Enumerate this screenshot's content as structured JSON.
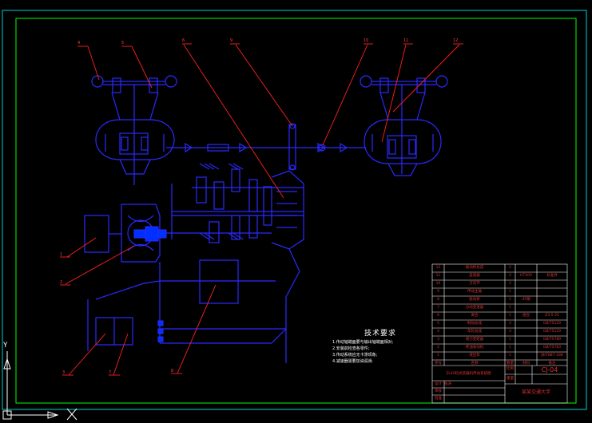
{
  "drawing": {
    "colors": {
      "background": "#000000",
      "border": "#00ff00",
      "frame": "#00d0d0",
      "mechanism": "#2a2aff",
      "leader": "#ff2020",
      "part_fill": "#0030ff"
    },
    "callouts": [
      "4",
      "5",
      "6",
      "9",
      "10",
      "11",
      "12",
      "1",
      "2",
      "3",
      "7",
      "8"
    ],
    "technical_requirements": {
      "title": "技术要求",
      "items": [
        "1.传动轴端面要与输出轴端面相对;",
        "2.安装前检查各零件;",
        "3.传动系统应无卡滞现象;",
        "4.减速器需要加油润滑."
      ]
    },
    "bom": {
      "rows": [
        {
          "no": "12",
          "name": "驱动桥总成",
          "qty": "2",
          "material": "",
          "note": ""
        },
        {
          "no": "11",
          "name": "差速器",
          "qty": "2",
          "material": "HT200",
          "note": "标准件"
        },
        {
          "no": "10",
          "name": "万向节",
          "qty": "2",
          "material": "",
          "note": ""
        },
        {
          "no": "9",
          "name": "传动主轴",
          "qty": "1",
          "material": "",
          "note": ""
        },
        {
          "no": "8",
          "name": "驱动桥",
          "qty": "1",
          "material": "45钢",
          "note": ""
        },
        {
          "no": "7",
          "name": "分动变速器",
          "qty": "1",
          "material": "",
          "note": ""
        },
        {
          "no": "6",
          "name": "离合",
          "qty": "1",
          "material": "组合",
          "note": "Z3.5-25"
        },
        {
          "no": "5",
          "name": "制动总成",
          "qty": "2",
          "material": "",
          "note": "GB/T5120"
        },
        {
          "no": "4",
          "name": "车轮总成",
          "qty": "4",
          "material": "",
          "note": "GB/T5120"
        },
        {
          "no": "3",
          "name": "液力变矩器",
          "qty": "1",
          "material": "",
          "note": "GB/T5780"
        },
        {
          "no": "2",
          "name": "柴油发动机",
          "qty": "1",
          "material": "",
          "note": "GB/T5783"
        },
        {
          "no": "1",
          "name": "液压泵",
          "qty": "1",
          "material": "",
          "note": "JB/T887-188"
        }
      ],
      "header": {
        "no": "序号",
        "name": "名称",
        "qty": "数量",
        "material": "材料",
        "note": "备注"
      },
      "drawing_title": "ZL40轮式装载机传动系统图",
      "drawing_number": "CJ-04",
      "label_design": "设计",
      "label_check": "审核",
      "label_approve": "批准",
      "label_scale": "比例",
      "label_weight": "重量",
      "designer": "张浩",
      "school": "某某交通大学"
    },
    "ucs": {
      "x_label": "X",
      "y_label": "Y"
    }
  }
}
